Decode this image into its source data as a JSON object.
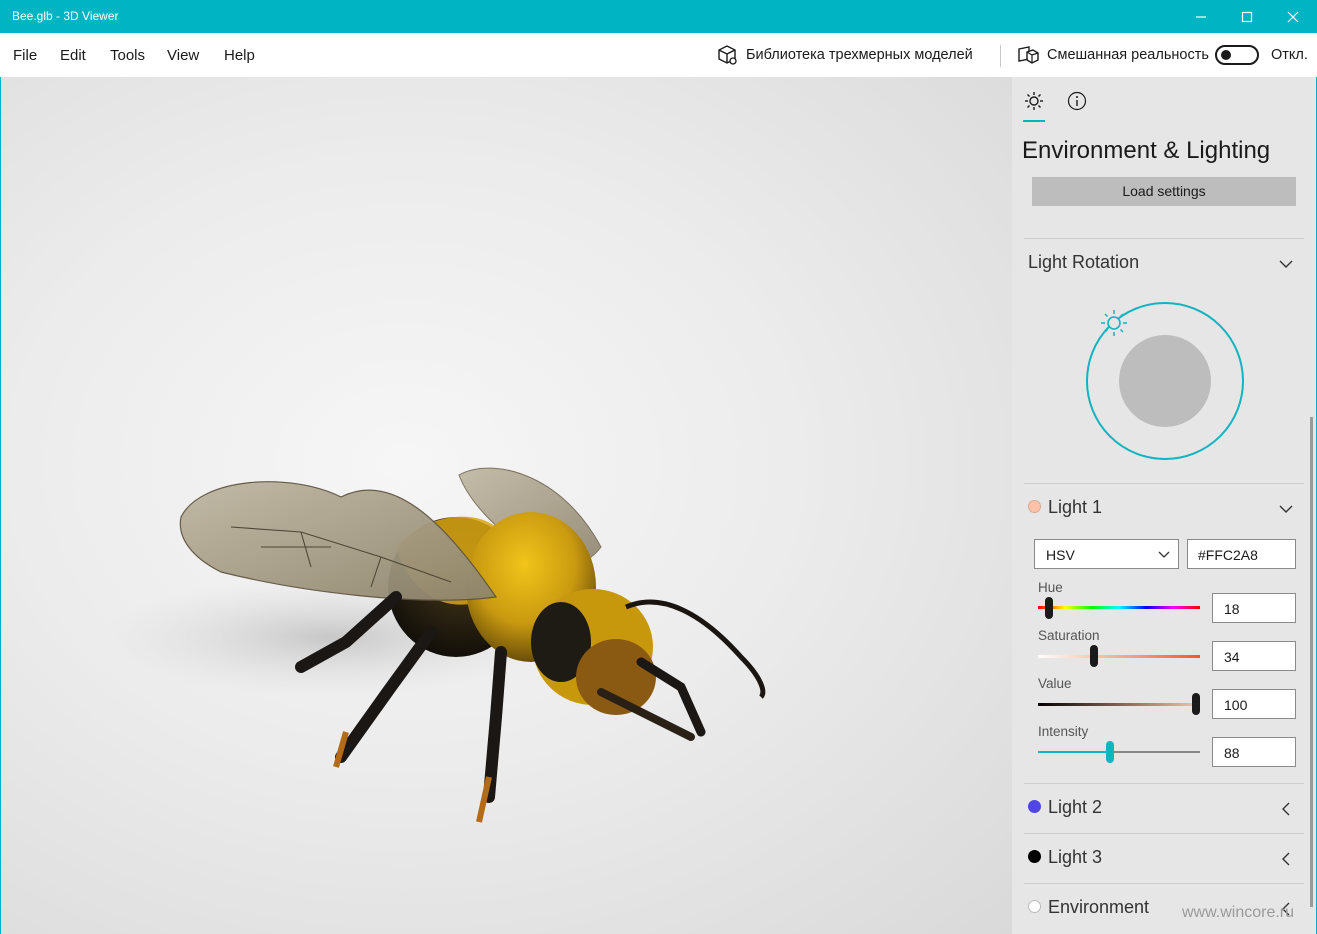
{
  "window": {
    "title": "Bee.glb - 3D Viewer"
  },
  "menu": {
    "file": "File",
    "edit": "Edit",
    "tools": "Tools",
    "view": "View",
    "help": "Help",
    "library_label": "Библиотека трехмерных моделей",
    "mixed_reality_label": "Смешанная реальность",
    "toggle_state": "Откл."
  },
  "panel": {
    "tabs": [
      "lighting",
      "info"
    ],
    "title": "Environment & Lighting",
    "load_settings": "Load settings",
    "light_rotation": "Light Rotation",
    "light1": {
      "label": "Light 1",
      "color": "#FFC2A8",
      "mode": "HSV",
      "hex": "#FFC2A8",
      "hue_label": "Hue",
      "hue": "18",
      "saturation_label": "Saturation",
      "saturation": "34",
      "value_label": "Value",
      "value": "100",
      "intensity_label": "Intensity",
      "intensity": "88"
    },
    "light2": {
      "label": "Light 2",
      "color": "#4f46e5"
    },
    "light3": {
      "label": "Light 3",
      "color": "#000000"
    },
    "environment": {
      "label": "Environment",
      "color": "#ffffff"
    }
  },
  "watermark": "www.wincore.ru",
  "colors": {
    "accent": "#00b4c3",
    "panel_bg": "#e6e6e6"
  }
}
